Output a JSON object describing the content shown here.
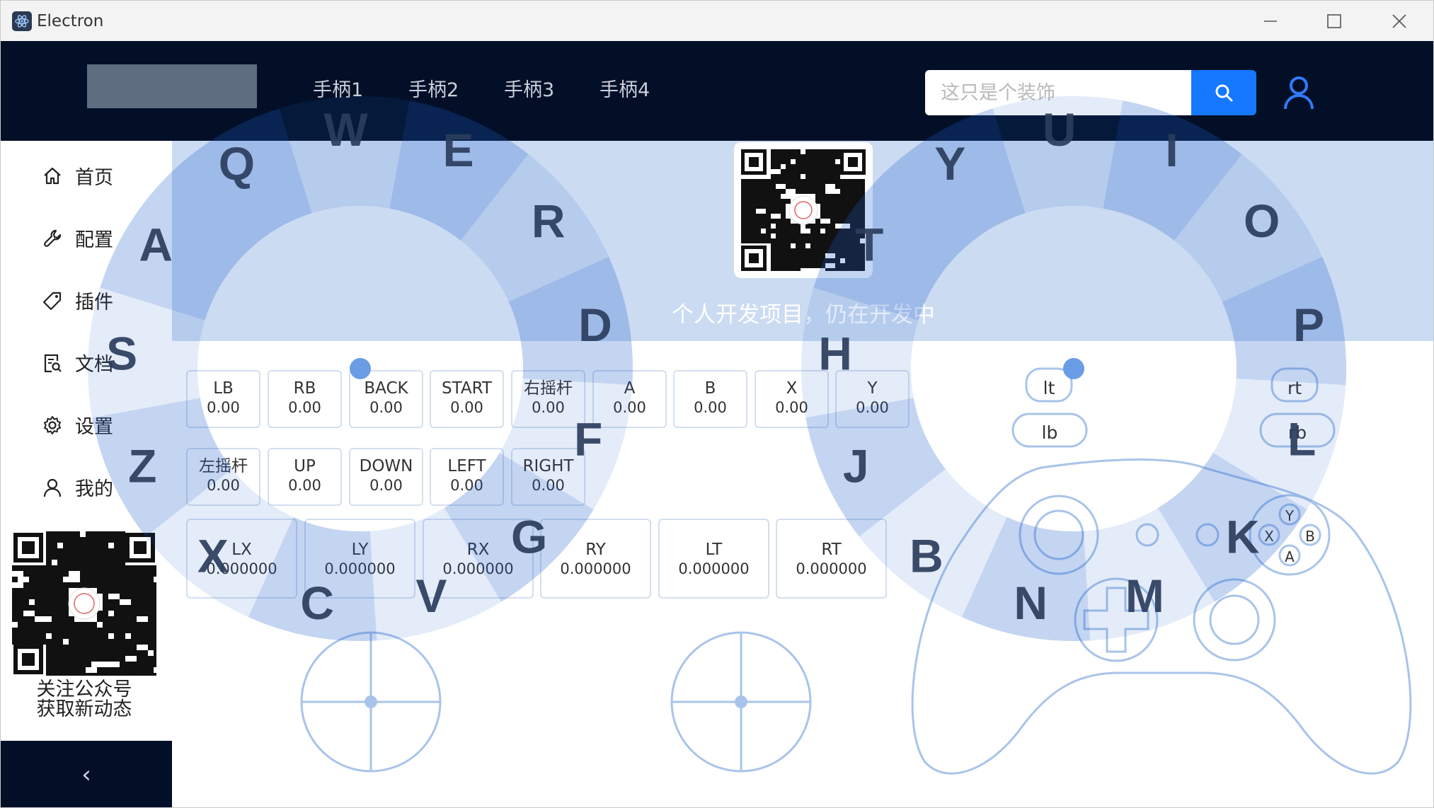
{
  "window": {
    "title": "Electron"
  },
  "header": {
    "tabs": [
      "手柄1",
      "手柄2",
      "手柄3",
      "手柄4"
    ],
    "search": {
      "placeholder": "这只是个装饰"
    }
  },
  "sidebar": {
    "items": [
      {
        "label": "首页",
        "icon": "home-icon"
      },
      {
        "label": "配置",
        "icon": "wrench-icon"
      },
      {
        "label": "插件",
        "icon": "tag-icon"
      },
      {
        "label": "文档",
        "icon": "document-search-icon"
      },
      {
        "label": "设置",
        "icon": "gear-icon"
      },
      {
        "label": "我的",
        "icon": "user-icon"
      }
    ],
    "follow_text_1": "关注公众号",
    "follow_text_2": "获取新动态",
    "collapse_icon": "‹"
  },
  "main": {
    "status_text": "个人开发项目，仍在开发中",
    "buttons_row1": [
      {
        "label": "LB",
        "value": "0.00"
      },
      {
        "label": "RB",
        "value": "0.00"
      },
      {
        "label": "BACK",
        "value": "0.00"
      },
      {
        "label": "START",
        "value": "0.00"
      },
      {
        "label": "右摇杆",
        "value": "0.00"
      },
      {
        "label": "A",
        "value": "0.00"
      },
      {
        "label": "B",
        "value": "0.00"
      },
      {
        "label": "X",
        "value": "0.00"
      },
      {
        "label": "Y",
        "value": "0.00"
      }
    ],
    "buttons_row2": [
      {
        "label": "左摇杆",
        "value": "0.00"
      },
      {
        "label": "UP",
        "value": "0.00"
      },
      {
        "label": "DOWN",
        "value": "0.00"
      },
      {
        "label": "LEFT",
        "value": "0.00"
      },
      {
        "label": "RIGHT",
        "value": "0.00"
      }
    ],
    "axes": [
      {
        "label": "LX",
        "value": "0.000000"
      },
      {
        "label": "LY",
        "value": "0.000000"
      },
      {
        "label": "RX",
        "value": "0.000000"
      },
      {
        "label": "RY",
        "value": "0.000000"
      },
      {
        "label": "LT",
        "value": "0.000000"
      },
      {
        "label": "RT",
        "value": "0.000000"
      }
    ],
    "triggers": {
      "lt": "lt",
      "lb": "lb",
      "rt": "rt",
      "rb": "rb"
    },
    "face_buttons": {
      "y": "Y",
      "x": "X",
      "b": "B",
      "a": "A"
    }
  },
  "keyboard_overlay": {
    "left_keys": [
      "Q",
      "W",
      "E",
      "R",
      "D",
      "F",
      "G",
      "V",
      "C",
      "X",
      "Z",
      "S",
      "A"
    ],
    "right_keys": [
      "Y",
      "U",
      "I",
      "O",
      "P",
      "L",
      "K",
      "M",
      "N",
      "B",
      "J",
      "H",
      "T"
    ]
  },
  "colors": {
    "header_bg": "#020f27",
    "accent": "#1677ff",
    "band": "#cbdbf2",
    "wheel": "#1f5fcc"
  }
}
